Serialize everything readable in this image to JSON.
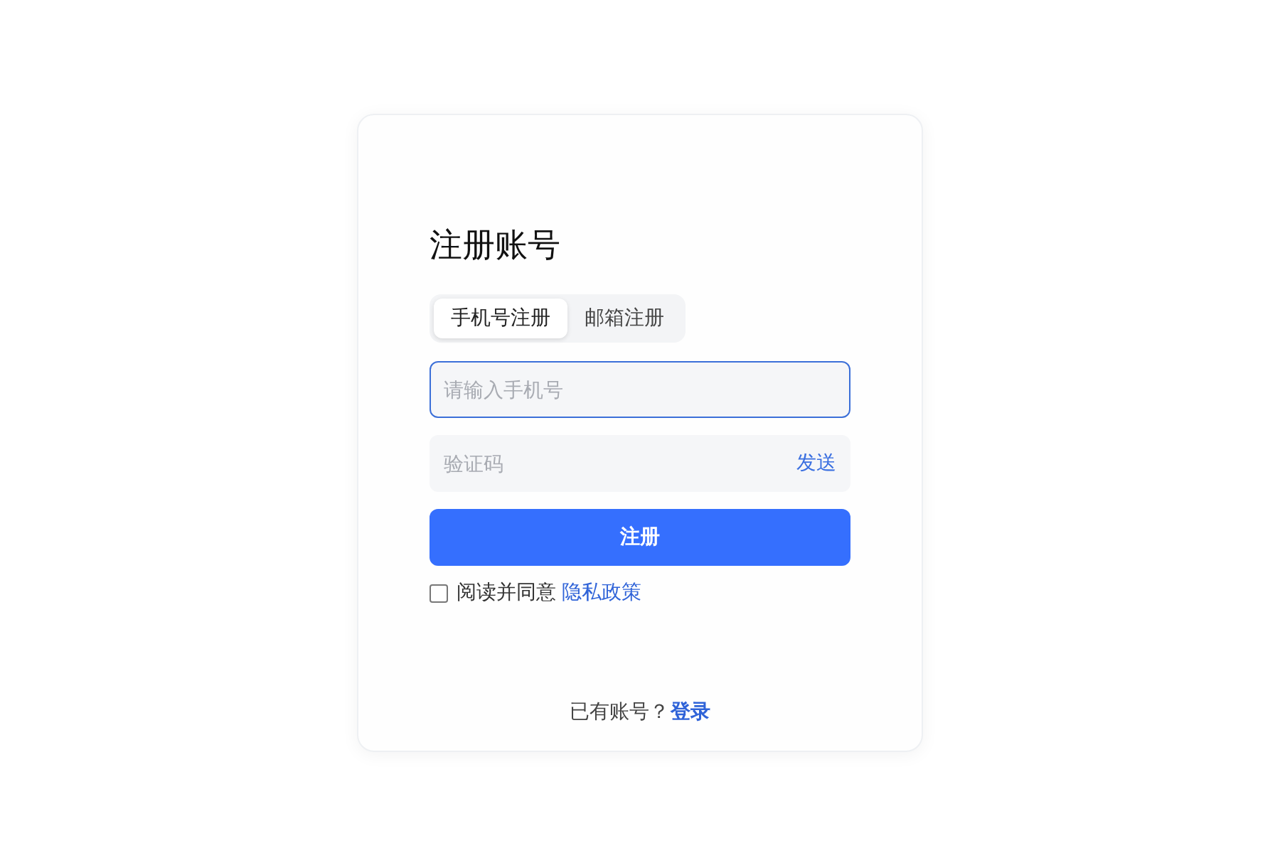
{
  "title": "注册账号",
  "tabs": [
    {
      "label": "手机号注册",
      "selected": true
    },
    {
      "label": "邮箱注册",
      "selected": false
    }
  ],
  "phone_field": {
    "placeholder": "请输入手机号",
    "focused": true
  },
  "code_field": {
    "placeholder": "验证码",
    "focused": false,
    "send_link": "发送"
  },
  "submit_button": "注册",
  "agreement": {
    "checked": false,
    "text": "阅读并同意",
    "link": "隐私政策"
  },
  "footer": {
    "text": "已有账号？",
    "link": "登录"
  }
}
